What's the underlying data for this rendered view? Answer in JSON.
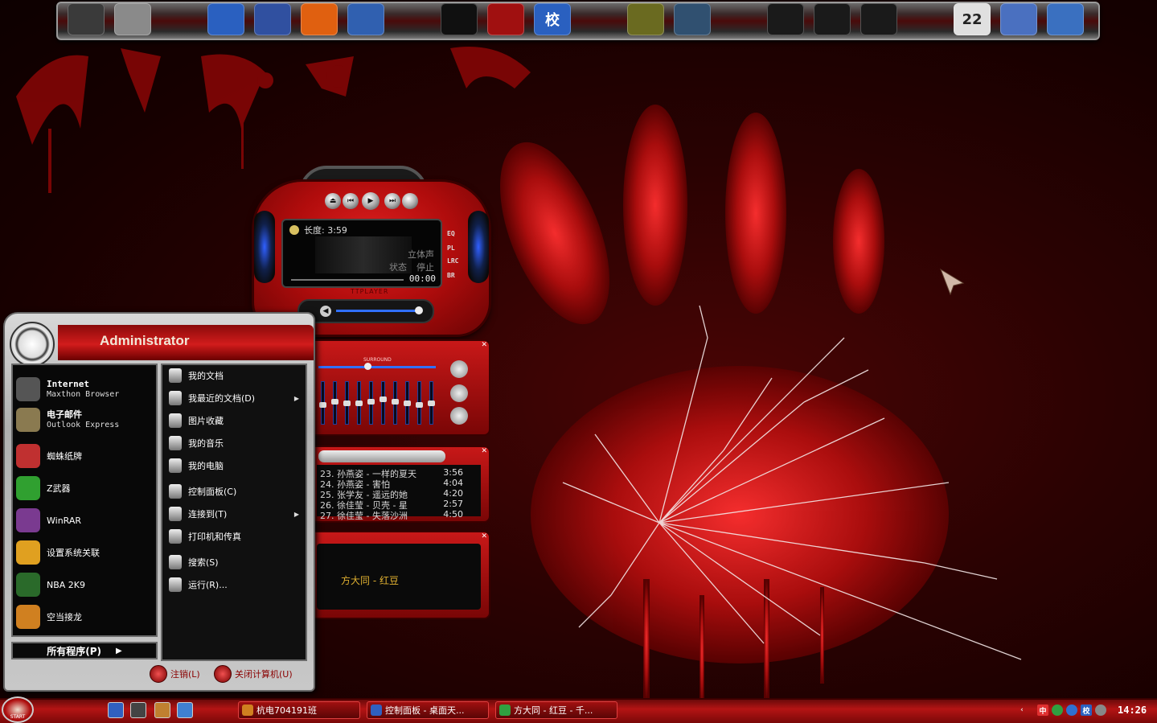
{
  "dock": {
    "icons": [
      {
        "name": "safe-icon"
      },
      {
        "name": "recycle-bin-icon"
      },
      {
        "name": "cursor-icon"
      },
      {
        "name": "home-icon"
      },
      {
        "name": "blogger-icon"
      },
      {
        "name": "pen-icon"
      },
      {
        "name": "qq-icon"
      },
      {
        "name": "robot-icon"
      },
      {
        "name": "school-icon",
        "label": "校"
      },
      {
        "name": "book-icon"
      },
      {
        "name": "helmet-icon"
      },
      {
        "name": "cartoon-face-1-icon"
      },
      {
        "name": "cartoon-face-2-icon"
      },
      {
        "name": "cartoon-face-3-icon"
      },
      {
        "name": "calendar-icon",
        "label": "22"
      },
      {
        "name": "settings-icon"
      },
      {
        "name": "network-icon"
      }
    ]
  },
  "player": {
    "length_label": "长度: 3:59",
    "mode_stereo": "立体声",
    "status_label": "状态",
    "status_value": "停止",
    "time": "00:00",
    "brand": "TTPLAYER",
    "mode_buttons": [
      "EQ",
      "PL",
      "LRC",
      "BR"
    ],
    "eq_label": "SURROUND",
    "eq_levels": [
      0.45,
      0.55,
      0.5,
      0.5,
      0.55,
      0.6,
      0.55,
      0.5,
      0.45,
      0.5
    ],
    "playlist": [
      {
        "title": "23. 孙燕姿 - 一样的夏天",
        "time": "3:56"
      },
      {
        "title": "24. 孙燕姿 - 害怕",
        "time": "4:04"
      },
      {
        "title": "25. 张学友 - 遥远的她",
        "time": "4:20"
      },
      {
        "title": "26. 徐佳莹 - 贝壳 - 星",
        "time": "2:57"
      },
      {
        "title": "27. 徐佳莹 - 失落沙洲",
        "time": "4:50"
      }
    ],
    "lyric": "方大同 - 红豆"
  },
  "start_menu": {
    "user": "Administrator",
    "pinned": [
      {
        "title": "Internet",
        "subtitle": "Maxthon Browser",
        "name": "maxthon-browser-item",
        "color": "#555555"
      },
      {
        "title": "电子邮件",
        "subtitle": "Outlook Express",
        "name": "outlook-express-item",
        "color": "#8a7a50"
      }
    ],
    "recent": [
      {
        "label": "蜘蛛纸牌",
        "name": "spider-solitaire-item",
        "color": "#c03030"
      },
      {
        "label": "Z武器",
        "name": "z-weapon-item",
        "color": "#30a030"
      },
      {
        "label": "WinRAR",
        "name": "winrar-item",
        "color": "#7a3a90"
      },
      {
        "label": "设置系统关联",
        "name": "file-association-item",
        "color": "#e0a020"
      },
      {
        "label": "NBA 2K9",
        "name": "nba-2k9-item",
        "color": "#2a6a2a"
      },
      {
        "label": "空当接龙",
        "name": "freecell-item",
        "color": "#d08020"
      }
    ],
    "all_programs": "所有程序(P)",
    "places": [
      {
        "label": "我的文档",
        "name": "my-documents-item"
      },
      {
        "label": "我最近的文档(D)",
        "name": "recent-documents-item",
        "arrow": true
      },
      {
        "label": "图片收藏",
        "name": "my-pictures-item"
      },
      {
        "label": "我的音乐",
        "name": "my-music-item"
      },
      {
        "label": "我的电脑",
        "name": "my-computer-item"
      },
      {
        "label": "控制面板(C)",
        "name": "control-panel-item"
      },
      {
        "label": "连接到(T)",
        "name": "connect-to-item",
        "arrow": true
      },
      {
        "label": "打印机和传真",
        "name": "printers-faxes-item"
      },
      {
        "label": "搜索(S)",
        "name": "search-item"
      },
      {
        "label": "运行(R)...",
        "name": "run-item"
      }
    ],
    "logoff": "注销(L)",
    "shutdown": "关闭计算机(U)"
  },
  "taskbar": {
    "start_label": "START",
    "tasks": [
      {
        "label": "杭电704191班",
        "name": "task-hdu-class"
      },
      {
        "label": "控制面板 - 桌面天...",
        "name": "task-control-panel"
      },
      {
        "label": "方大同 - 红豆 - 千...",
        "name": "task-player"
      }
    ],
    "tray_ime": "中",
    "tray_school": "校",
    "clock": "14:26"
  }
}
